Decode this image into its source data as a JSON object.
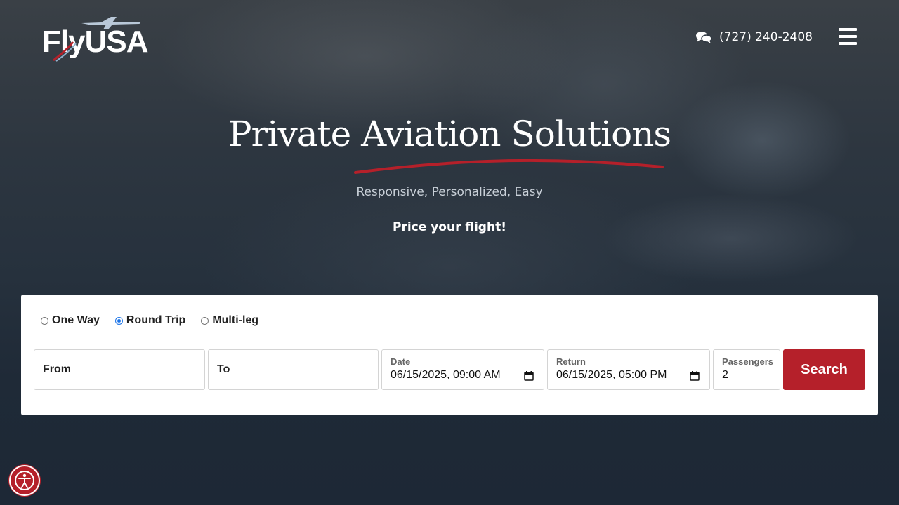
{
  "header": {
    "logo_text": "FlyUSA",
    "phone": "(727) 240-2408",
    "menu_icon": "hamburger-menu-icon",
    "chat_icon": "chat-bubbles-icon"
  },
  "hero": {
    "title": "Private Aviation Solutions",
    "subtitle": "Responsive, Personalized, Easy",
    "cta": "Price your flight!"
  },
  "search": {
    "trip_types": [
      {
        "label": "One Way",
        "checked": false
      },
      {
        "label": "Round Trip",
        "checked": true
      },
      {
        "label": "Multi-leg",
        "checked": false
      }
    ],
    "from_placeholder": "From",
    "to_placeholder": "To",
    "date_label": "Date",
    "date_value": "06/15/2025, 09:00 AM",
    "return_label": "Return",
    "return_value": "06/15/2025, 05:00 PM",
    "passengers_label": "Passengers",
    "passengers_value": "2",
    "search_label": "Search"
  },
  "colors": {
    "accent": "#b5202a",
    "background": "#1e2a38",
    "radio_checked": "#1a73e8"
  },
  "accessibility": {
    "icon": "accessibility-icon"
  }
}
